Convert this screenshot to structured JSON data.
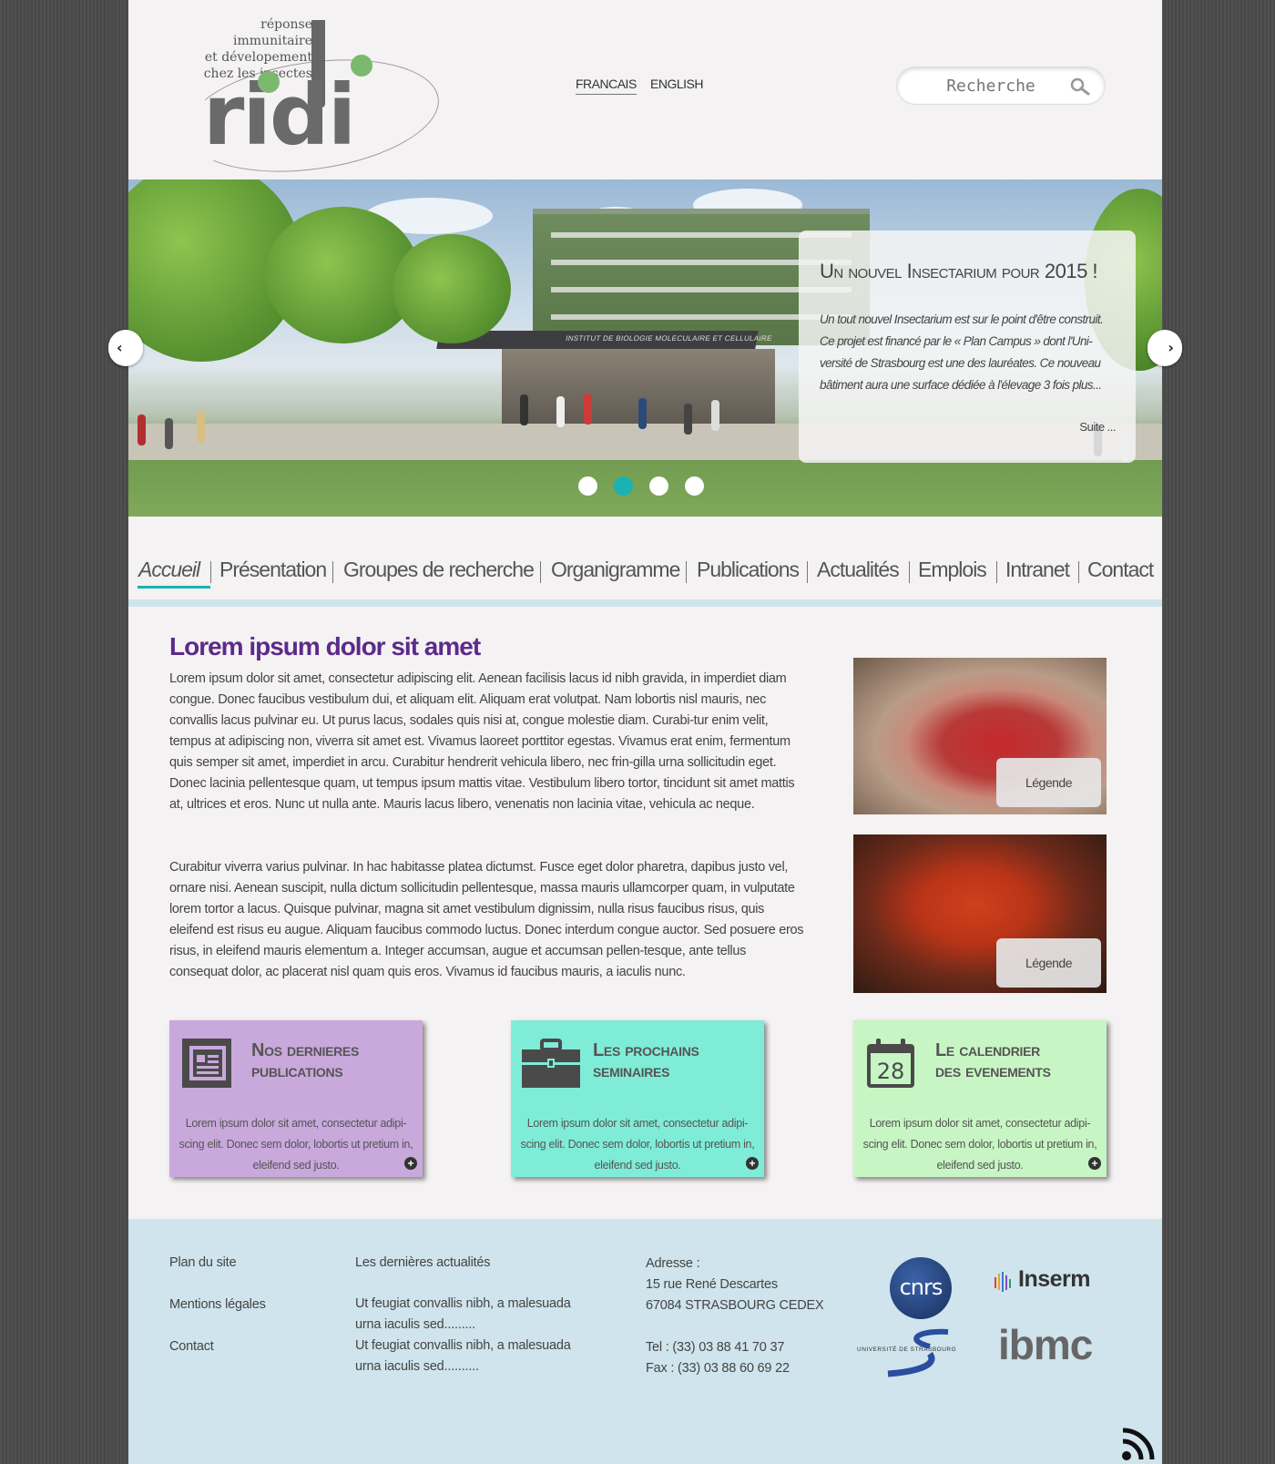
{
  "header": {
    "logo_tagline": [
      "réponse immunitaire",
      "et dévelopement",
      "chez les insectes"
    ],
    "logo_word": "ridi",
    "languages": [
      "FRANCAIS",
      "ENGLISH"
    ],
    "active_language": "FRANCAIS",
    "search_placeholder": "Recherche"
  },
  "slider": {
    "title": "Un nouvel Insectarium pour 2015 !",
    "text": "Un tout nouvel Insectarium est sur le point d'être construit. Ce projet est financé par le « Plan Campus » dont l'Uni-versité de Strasbourg est une des lauréates. Ce nouveau bâtiment aura une surface dédiée à l'élevage 3 fois plus...",
    "more": "Suite ...",
    "building_sign": "INSTITUT DE BIOLOGIE MOLECULAIRE ET CELLULAIRE",
    "prev_label": "‹",
    "next_label": "›",
    "slide_count": 4,
    "active_slide": 2
  },
  "nav": {
    "items": [
      "Accueil",
      "Présentation",
      "Groupes de recherche",
      "Organigramme",
      "Publications",
      "Actualités",
      "Emplois",
      "Intranet",
      "Contact"
    ],
    "active": "Accueil"
  },
  "content": {
    "title": "Lorem ipsum dolor sit amet",
    "paragraph1": "Lorem ipsum dolor sit amet, consectetur adipiscing elit. Aenean facilisis lacus id nibh gravida, in imperdiet diam congue. Donec faucibus vestibulum dui, et aliquam elit. Aliquam erat volutpat. Nam lobortis nisl mauris, nec convallis lacus pulvinar eu. Ut purus lacus, sodales quis nisi at, congue molestie diam. Curabi-tur enim velit, tempus at adipiscing non, viverra sit amet est. Vivamus laoreet porttitor egestas. Vivamus erat enim, fermentum quis semper sit amet, imperdiet in arcu. Curabitur hendrerit vehicula libero, nec frin-gilla urna sollicitudin eget. Donec lacinia pellentesque quam, ut tempus ipsum mattis vitae. Vestibulum libero tortor, tincidunt sit amet mattis at, ultrices et eros. Nunc ut nulla ante. Mauris lacus libero, venenatis non lacinia vitae, vehicula ac neque.",
    "paragraph2": "Curabitur viverra varius pulvinar. In hac habitasse platea dictumst. Fusce eget dolor pharetra, dapibus justo vel, ornare nisi. Aenean suscipit, nulla dictum sollicitudin pellentesque, massa mauris ullamcorper quam, in vulputate lorem tortor a lacus. Quisque pulvinar, magna sit amet vestibulum dignissim, nulla risus faucibus risus, quis eleifend est risus eu augue. Aliquam faucibus commodo luctus. Donec interdum congue auctor. Sed posuere eros risus, in eleifend mauris elementum a. Integer accumsan, augue et accumsan pellen-tesque, ante tellus consequat dolor, ac placerat nisl quam quis eros. Vivamus id faucibus mauris, a iaculis nunc.",
    "photos": [
      {
        "caption": "Légende"
      },
      {
        "caption": "Légende"
      }
    ]
  },
  "cards": [
    {
      "title_line1": "Nos dernieres",
      "title_line2": "publications",
      "text": "Lorem ipsum dolor sit amet, consectetur adipi-scing elit. Donec sem dolor, lobortis ut pretium in, eleifend sed justo.",
      "color": "#c9a8dc",
      "icon": "newspaper-icon"
    },
    {
      "title_line1": "Les prochains",
      "title_line2": "seminaires",
      "text": "Lorem ipsum dolor sit amet, consectetur adipi-scing elit. Donec sem dolor, lobortis ut pretium in, eleifend sed justo.",
      "color": "#7fecd8",
      "icon": "briefcase-icon"
    },
    {
      "title_line1": "Le calendrier",
      "title_line2": "des evenements",
      "text": "Lorem ipsum dolor sit amet, consectetur adipi-scing elit. Donec sem dolor, lobortis ut pretium in, eleifend sed justo.",
      "color": "#c8f5c4",
      "icon": "calendar-icon",
      "calendar_day": "28"
    }
  ],
  "footer": {
    "links": [
      "Plan du site",
      "Mentions légales",
      "Contact"
    ],
    "news_title": "Les dernières actualités",
    "news": [
      "Ut feugiat convallis nibh, a malesuada urna iaculis sed.........",
      "Ut feugiat convallis nibh, a malesuada urna iaculis sed.........."
    ],
    "address_label": "Adresse :",
    "address_line1": "15 rue René Descartes",
    "address_line2": "67084 STRASBOURG CEDEX",
    "tel": "Tel : (33) 03 88 41 70 37",
    "fax": "Fax : (33) 03 88 60 69 22",
    "partners": [
      "cnrs",
      "Inserm",
      "UNIVERSITÉ DE STRASBOURG",
      "ibmc"
    ]
  },
  "colors": {
    "accent": "#1ab2b2",
    "title": "#5c2a8a",
    "footer_bg": "#cfe4ec"
  }
}
